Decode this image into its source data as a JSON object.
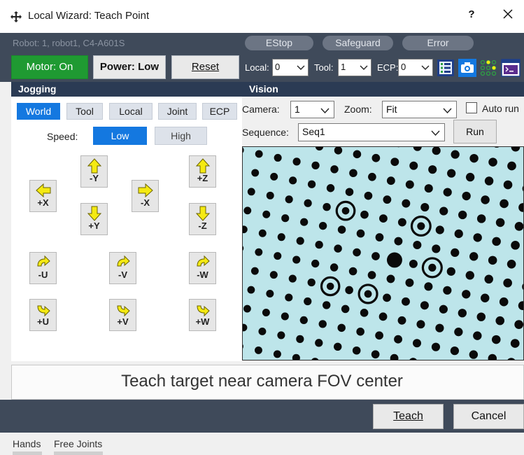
{
  "window": {
    "title": "Local Wizard: Teach Point",
    "help_label": "?"
  },
  "header": {
    "robot_info": "Robot: 1, robot1, C4-A601S",
    "pills": {
      "estop": "EStop",
      "safeguard": "Safeguard",
      "error": "Error"
    },
    "motor_label": "Motor: On",
    "power_label": "Power: Low",
    "reset_label": "Reset",
    "local_label": "Local:",
    "local_value": "0",
    "tool_label": "Tool:",
    "tool_value": "1",
    "ecp_label": "ECP:",
    "ecp_value": "0",
    "toolbar_icons": [
      "list-icon",
      "camera-icon",
      "io-grid-icon",
      "terminal-icon"
    ]
  },
  "jogging": {
    "section_title": "Jogging",
    "modes": [
      "World",
      "Tool",
      "Local",
      "Joint",
      "ECP"
    ],
    "active_mode": "World",
    "speed_label": "Speed:",
    "speed_low": "Low",
    "speed_high": "High",
    "active_speed": "Low",
    "buttons": {
      "plus_x": "+X",
      "minus_y": "-Y",
      "plus_y": "+Y",
      "minus_x": "-X",
      "plus_z": "+Z",
      "minus_z": "-Z",
      "minus_u": "-U",
      "minus_v": "-V",
      "minus_w": "-W",
      "plus_u": "+U",
      "plus_v": "+V",
      "plus_w": "+W"
    }
  },
  "vision": {
    "section_title": "Vision",
    "camera_label": "Camera:",
    "camera_value": "1",
    "zoom_label": "Zoom:",
    "zoom_value": "Fit",
    "autorun_label": "Auto run",
    "autorun_checked": false,
    "sequence_label": "Sequence:",
    "sequence_value": "Seq1",
    "run_label": "Run"
  },
  "prompt": "Teach target near camera FOV center",
  "footer": {
    "teach_label": "Teach",
    "cancel_label": "Cancel"
  },
  "tabs": [
    "Hands",
    "Free Joints"
  ],
  "colors": {
    "header_bg": "#3f4a5a",
    "section_bg": "#2b3b54",
    "accent_blue": "#1478e0",
    "motor_green": "#1f9a32",
    "arrow_yellow": "#f5ea12",
    "camera_bg": "#bde5ea"
  }
}
